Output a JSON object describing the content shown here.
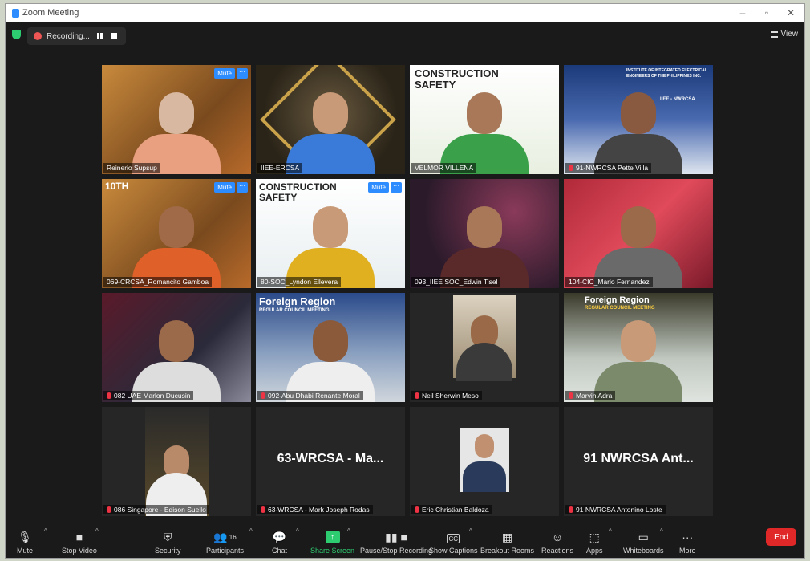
{
  "window": {
    "title": "Zoom Meeting"
  },
  "top": {
    "recording_label": "Recording...",
    "view_label": "View"
  },
  "tiles": [
    {
      "name": "Reinerio Supsup",
      "mute": "Mute"
    },
    {
      "name": "IIEE-ERCSA"
    },
    {
      "name": "VELMOR VILLENA",
      "banner": "CONSTRUCTION SAFETY"
    },
    {
      "name": "91-NWRCSA Pette Villa",
      "banner": "INSTITUTE OF INTEGRATED ELECTRICAL ENGINEERS OF THE PHILIPPINES INC.",
      "banner2": "IIEE - NWRCSA"
    },
    {
      "name": "069-CRCSA_Romancito Gamboa",
      "mute": "Mute",
      "banner": "10TH"
    },
    {
      "name": "80-SOC_Lyndon Ellevera",
      "mute": "Mute",
      "banner": "CONSTRUCTION SAFETY"
    },
    {
      "name": "093_IIEE SOC_Edwin Tisel"
    },
    {
      "name": "104-CIC_Mario Fernandez"
    },
    {
      "name": "082 UAE Marlon Ducusin"
    },
    {
      "name": "092-Abu Dhabi Renante Moral",
      "banner": "Foreign Region",
      "banner2": "REGULAR COUNCIL MEETING"
    },
    {
      "name": "Neil Sherwin Meso"
    },
    {
      "name": "Marvin Adra",
      "banner": "Foreign Region",
      "banner2": "REGULAR COUNCIL MEETING"
    },
    {
      "name": "086 Singapore - Edison Suello"
    },
    {
      "name": "63-WRCSA - Mark Joseph Rodas",
      "big": "63-WRCSA - Ma..."
    },
    {
      "name": "Eric Christian Baldoza"
    },
    {
      "name": "91 NWRCSA Antonino Loste",
      "big": "91 NWRCSA Ant..."
    }
  ],
  "toolbar": {
    "mute": "Mute",
    "video": "Stop Video",
    "security": "Security",
    "participants": "Participants",
    "participants_count": "16",
    "chat": "Chat",
    "share": "Share Screen",
    "record": "Pause/Stop Recording",
    "captions": "Show Captions",
    "breakout": "Breakout Rooms",
    "reactions": "Reactions",
    "apps": "Apps",
    "whiteboards": "Whiteboards",
    "more": "More",
    "end": "End"
  },
  "colors": {
    "share_green": "#2ecc71",
    "end_red": "#e02828",
    "zoom_blue": "#2d8cff",
    "active_speaker": "#c8e04a"
  }
}
